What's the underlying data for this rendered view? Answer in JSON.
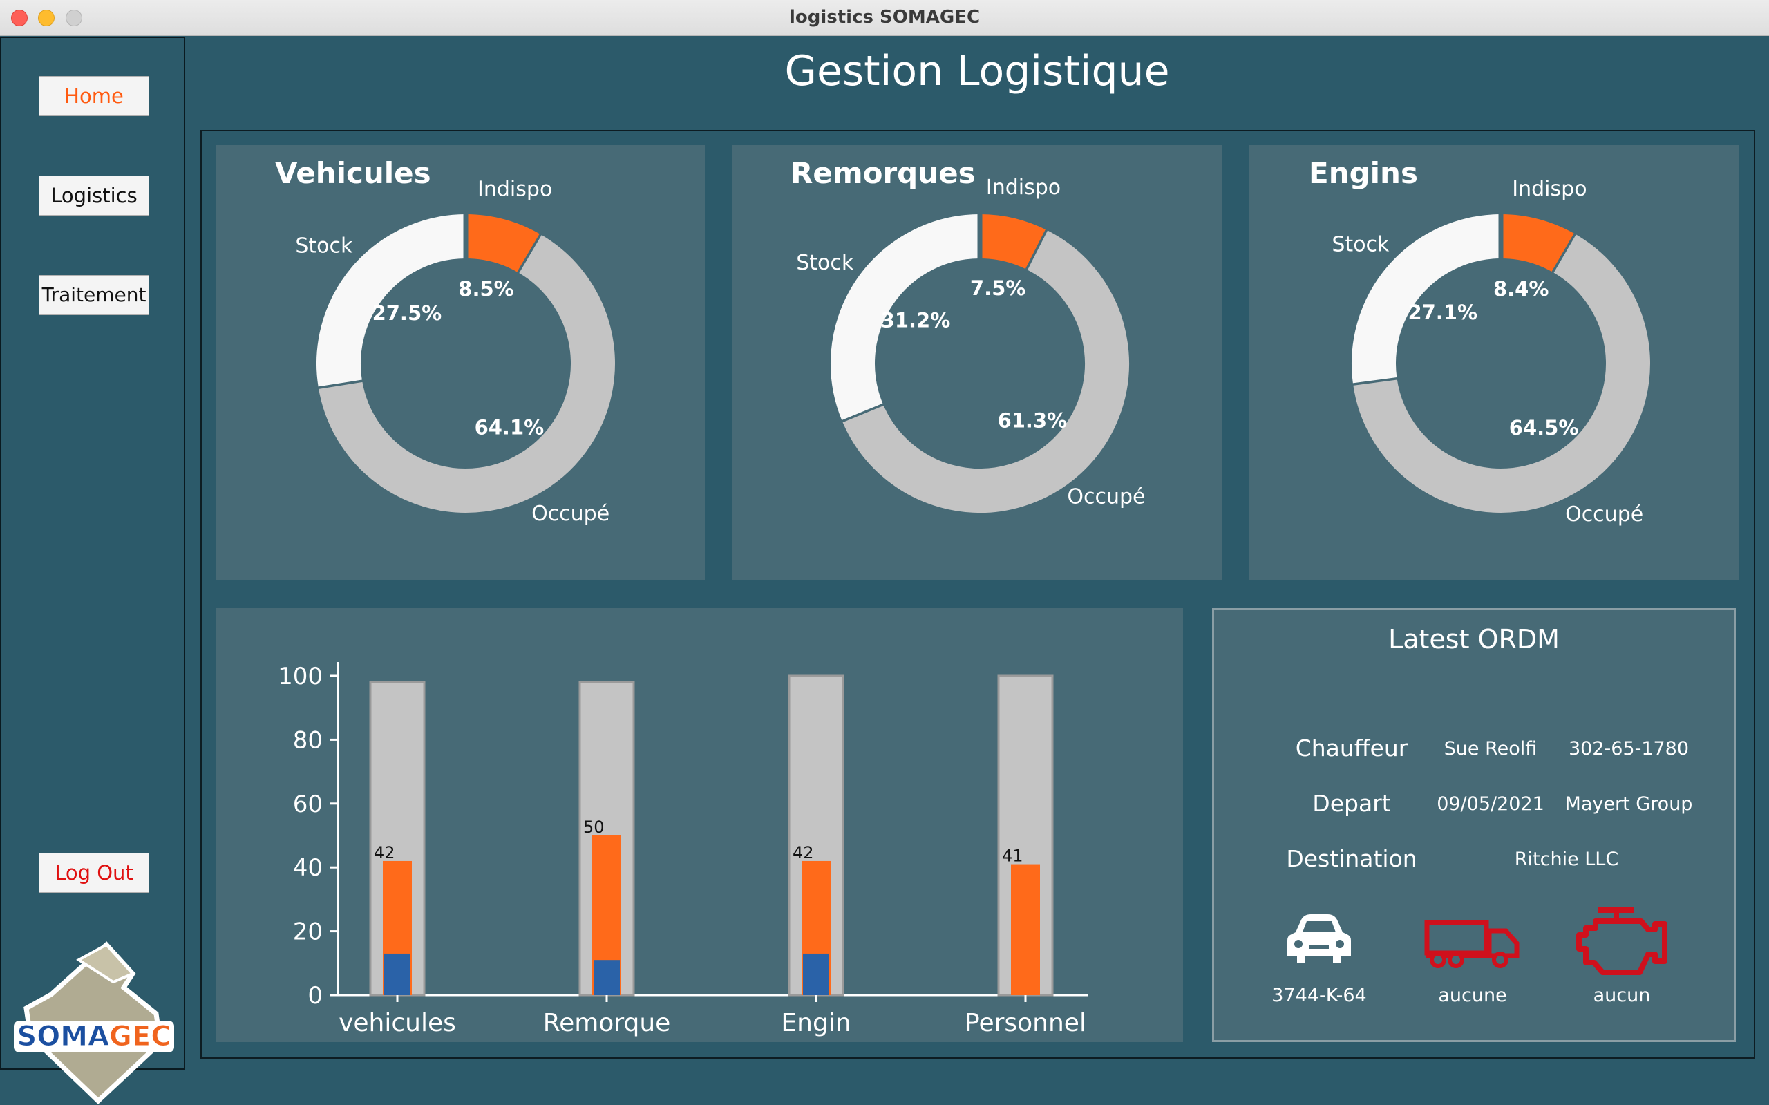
{
  "window": {
    "title": "logistics SOMAGEC"
  },
  "sidebar": {
    "home_label": "Home",
    "logistics_label": "Logistics",
    "traitement_label": "Traitement",
    "logout_label": "Log Out",
    "logo_text": "SOMAGEC"
  },
  "page": {
    "title": "Gestion Logistique"
  },
  "colors": {
    "accent": "#ff6a1a",
    "stock": "#f8f8f8",
    "occupe": "#c4c4c4",
    "blue": "#2a62a8",
    "panel": "#476a76",
    "bg": "#2c5a6a",
    "icon_red": "#d0101c"
  },
  "chart_data": [
    {
      "type": "pie",
      "title": "Vehicules",
      "labels": [
        "Stock",
        "Indispo",
        "Occupé"
      ],
      "values": [
        27.5,
        8.5,
        64.1
      ],
      "value_labels": [
        "27.5%",
        "8.5%",
        "64.1%"
      ]
    },
    {
      "type": "pie",
      "title": "Remorques",
      "labels": [
        "Stock",
        "Indispo",
        "Occupé"
      ],
      "values": [
        31.2,
        7.5,
        61.3
      ],
      "value_labels": [
        "31.2%",
        "7.5%",
        "61.3%"
      ]
    },
    {
      "type": "pie",
      "title": "Engins",
      "labels": [
        "Stock",
        "Indispo",
        "Occupé"
      ],
      "values": [
        27.1,
        8.4,
        64.5
      ],
      "value_labels": [
        "27.1%",
        "8.4%",
        "64.5%"
      ]
    },
    {
      "type": "bar",
      "categories": [
        "vehicules",
        "Remorque",
        "Engin",
        "Personnel"
      ],
      "series": [
        {
          "values": [
            98,
            98,
            100,
            100
          ]
        },
        {
          "values": [
            42,
            50,
            42,
            41
          ]
        },
        {
          "values": [
            13,
            11,
            13,
            0
          ]
        }
      ],
      "bar_labels": [
        "42",
        "50",
        "42",
        "41"
      ],
      "ylim": [
        0,
        100
      ],
      "yticks": [
        0,
        20,
        40,
        60,
        80,
        100
      ]
    }
  ],
  "ordm": {
    "title": "Latest ORDM",
    "chauffeur_label": "Chauffeur",
    "chauffeur_name": "Sue Reolfi",
    "chauffeur_phone": "302-65-1780",
    "depart_label": "Depart",
    "depart_date": "09/05/2021",
    "depart_place": "Mayert Group",
    "destination_label": "Destination",
    "destination_value": "Ritchie LLC",
    "vehicle_value": "3744-K-64",
    "remorque_value": "aucune",
    "engin_value": "aucun",
    "vehicle_icon": "car-icon",
    "remorque_icon": "truck-icon",
    "engin_icon": "engine-icon"
  }
}
